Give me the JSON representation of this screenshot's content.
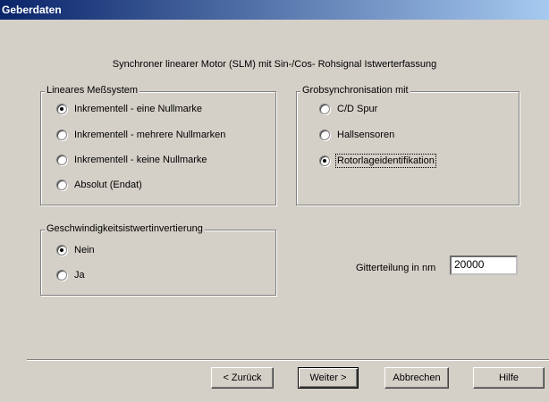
{
  "window": {
    "title": "Geberdaten"
  },
  "subtitle": "Synchroner linearer Motor (SLM) mit Sin-/Cos- Rohsignal Istwerterfassung",
  "groups": {
    "meas": {
      "legend": "Lineares Meßsystem",
      "options": [
        {
          "label": "Inkrementell - eine Nullmarke",
          "checked": true
        },
        {
          "label": "Inkrementell - mehrere Nullmarken",
          "checked": false
        },
        {
          "label": "Inkrementell - keine Nullmarke",
          "checked": false
        },
        {
          "label": "Absolut (Endat)",
          "checked": false
        }
      ]
    },
    "grob": {
      "legend": "Grobsynchronisation mit",
      "options": [
        {
          "label": "C/D Spur",
          "checked": false
        },
        {
          "label": "Hallsensoren",
          "checked": false
        },
        {
          "label": "Rotorlageidentifikation",
          "checked": true
        }
      ]
    },
    "speed": {
      "legend": "Geschwindigkeitsistwertinvertierung",
      "options": [
        {
          "label": "Nein",
          "checked": true
        },
        {
          "label": "Ja",
          "checked": false
        }
      ]
    }
  },
  "grid": {
    "label": "Gitterteilung in nm",
    "value": "20000"
  },
  "buttons": {
    "back": "< Zurück",
    "next": "Weiter >",
    "cancel": "Abbrechen",
    "help": "Hilfe"
  }
}
